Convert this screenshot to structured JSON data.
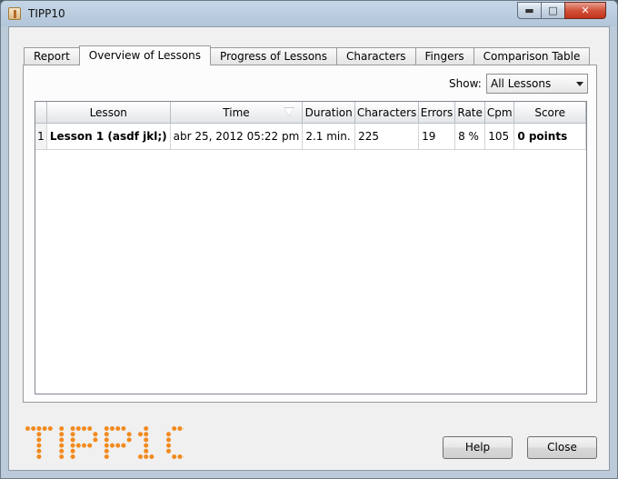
{
  "window": {
    "title": "TIPP10"
  },
  "tabs": [
    {
      "label": "Report",
      "active": false
    },
    {
      "label": "Overview of Lessons",
      "active": true
    },
    {
      "label": "Progress of Lessons",
      "active": false
    },
    {
      "label": "Characters",
      "active": false
    },
    {
      "label": "Fingers",
      "active": false
    },
    {
      "label": "Comparison Table",
      "active": false
    }
  ],
  "filter": {
    "label": "Show:",
    "selected": "All Lessons"
  },
  "table": {
    "columns": [
      "Lesson",
      "Time",
      "Duration",
      "Characters",
      "Errors",
      "Rate",
      "Cpm",
      "Score"
    ],
    "rows": [
      {
        "num": "1",
        "lesson": "Lesson 1 (asdf jkl;)",
        "time": "abr 25, 2012 05:22 pm",
        "duration": "2.1 min.",
        "characters": "225",
        "errors": "19",
        "rate": "8 %",
        "cpm": "105",
        "score": "0 points"
      }
    ]
  },
  "logo": {
    "text": "TIPP10",
    "color": "#f28a1e"
  },
  "buttons": {
    "help": "Help",
    "close": "Close"
  },
  "colors": {
    "titlebar": "#b2c6da",
    "close_button": "#c2331b",
    "window_bg": "#f0f0f0"
  }
}
